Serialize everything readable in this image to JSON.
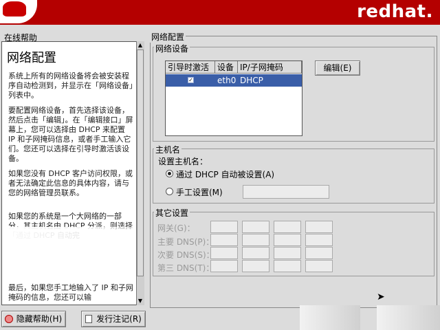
{
  "brand": "redhat.",
  "help": {
    "title": "在线帮助",
    "heading": "网络配置",
    "paragraphs": [
      "系统上所有的网络设备将会被安装程序自动检测到，并显示在「网络设备」列表中。",
      "要配置网络设备，首先选择该设备，然后点击「编辑」。在「编辑接口」屏幕上，您可以选择由 DHCP 来配置 IP 和子网掩码信息，或者手工输入它们。您还可以选择在引导时激活该设备。",
      "如果您没有 DHCP 客户访问权限，或者无法确定此信息的具体内容，请与您的网络管理员联系。",
      "如果您的系统是一个大网络的一部分，其主机名由 DHCP 分派，则选择「通过 DHCP 自动完",
      "最后，如果您手工地输入了 IP 和子网掩码的信息，您还可以输"
    ]
  },
  "main": {
    "frame_title": "网络配置",
    "devices": {
      "title": "网络设备",
      "columns": [
        "引导时激活",
        "设备",
        "IP/子网掩码"
      ],
      "rows": [
        {
          "active": "✓",
          "device": "eth0",
          "ip": "DHCP"
        }
      ],
      "edit_button": "编辑(E)"
    },
    "hostname": {
      "title": "主机名",
      "label": "设置主机名：",
      "option_dhcp": "通过 DHCP 自动被设置(A)",
      "option_manual": "手工设置(M)"
    },
    "other": {
      "title": "其它设置",
      "gateway": "网关(G)：",
      "dns1": "主要 DNS(P)：",
      "dns2": "次要 DNS(S)：",
      "dns3": "第三 DNS(T)："
    }
  },
  "bottom": {
    "hide_help": "隐藏帮助(H)",
    "release_notes": "发行注记(R)"
  }
}
